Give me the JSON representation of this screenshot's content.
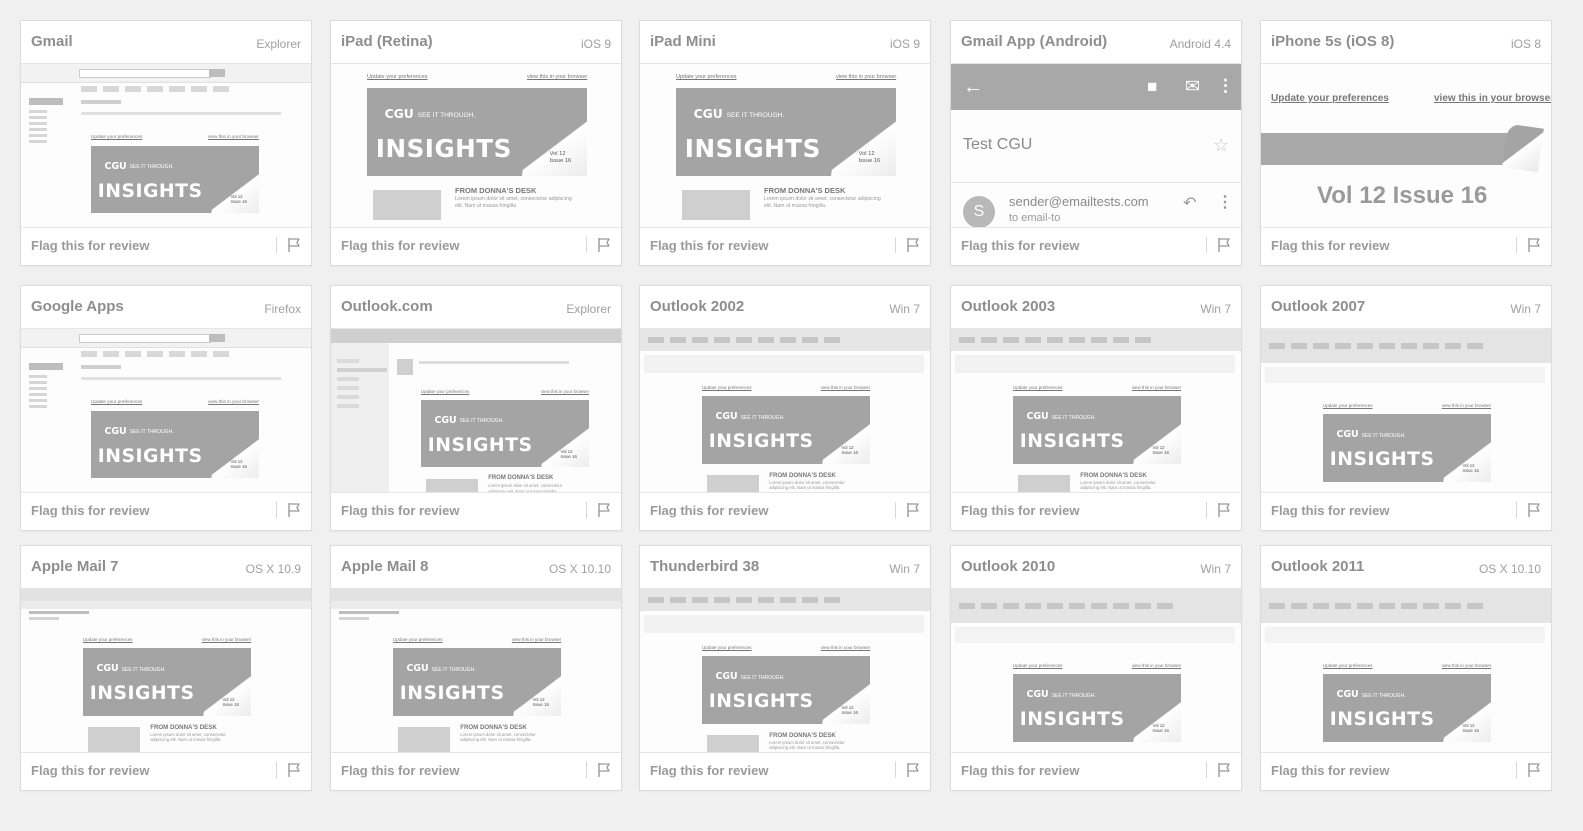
{
  "flag_label": "Flag this for review",
  "email": {
    "update_link": "Update your preferences",
    "browser_link": "view this in your browser",
    "banner_brand": "CGU",
    "banner_tagline": "SEE IT THROUGH.",
    "banner_title": "INSIGHTS",
    "vol_line": "Vol 12",
    "issue_line": "Issue 16",
    "desk_title": "FROM DONNA'S DESK",
    "desk_body": "Lorem ipsum dolor sit amet, consectetur adipiscing elit. Nam ut massa fringilla."
  },
  "gmail_android": {
    "subject": "Test CGU",
    "sender": "sender@emailtests.com",
    "to": "to email-to",
    "avatar_letter": "S"
  },
  "iphone": {
    "update_link": "Update your preferences",
    "browser_link": "view this in your browser",
    "vol_issue": "Vol 12 Issue 16"
  },
  "clients": [
    {
      "name": "Gmail",
      "platform": "Explorer",
      "style": "gmail"
    },
    {
      "name": "iPad (Retina)",
      "platform": "iOS 9",
      "style": "plain"
    },
    {
      "name": "iPad Mini",
      "platform": "iOS 9",
      "style": "plain"
    },
    {
      "name": "Gmail App (Android)",
      "platform": "Android 4.4",
      "style": "android"
    },
    {
      "name": "iPhone 5s (iOS 8)",
      "platform": "iOS 8",
      "style": "iphone"
    },
    {
      "name": "Google Apps",
      "platform": "Firefox",
      "style": "gmail"
    },
    {
      "name": "Outlook.com",
      "platform": "Explorer",
      "style": "outlookcom"
    },
    {
      "name": "Outlook 2002",
      "platform": "Win 7",
      "style": "desktop"
    },
    {
      "name": "Outlook 2003",
      "platform": "Win 7",
      "style": "desktop"
    },
    {
      "name": "Outlook 2007",
      "platform": "Win 7",
      "style": "ribbon"
    },
    {
      "name": "Apple Mail 7",
      "platform": "OS X 10.9",
      "style": "mac"
    },
    {
      "name": "Apple Mail 8",
      "platform": "OS X 10.10",
      "style": "mac"
    },
    {
      "name": "Thunderbird 38",
      "platform": "Win 7",
      "style": "desktop"
    },
    {
      "name": "Outlook 2010",
      "platform": "Win 7",
      "style": "ribbon"
    },
    {
      "name": "Outlook 2011",
      "platform": "OS X 10.10",
      "style": "ribbon"
    }
  ]
}
